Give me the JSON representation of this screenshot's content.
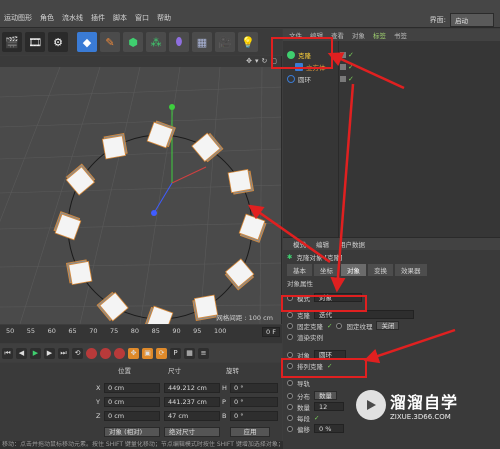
{
  "menubar": {
    "items": [
      "运动图形",
      "角色",
      "流水线",
      "插件",
      "脚本",
      "窗口",
      "帮助"
    ],
    "layout_label": "界面:",
    "layout_value": "启动"
  },
  "toolbar": {
    "icons": [
      "render-region-icon",
      "render-view-icon",
      "render-settings-icon",
      "cube-icon",
      "pen-icon",
      "subdivision-icon",
      "array-icon",
      "deformer-icon",
      "floor-icon",
      "camera-icon",
      "light-icon"
    ]
  },
  "viewport": {
    "grid_label": "网格间距 : 100 cm",
    "cubes_count": 12
  },
  "object_manager": {
    "tabs": [
      "文件",
      "编辑",
      "查看",
      "对象",
      "标签",
      "书签"
    ],
    "active_tab": "标签",
    "objects": [
      {
        "name": "克隆",
        "type": "cloner",
        "selected": true
      },
      {
        "name": "立方体",
        "type": "cube",
        "selected": false
      },
      {
        "name": "圆环",
        "type": "circle",
        "selected": false
      }
    ]
  },
  "attributes": {
    "head_tabs": [
      "模式",
      "编辑",
      "用户数据"
    ],
    "title": "克隆对象 [克隆]",
    "sub_tabs": [
      "基本",
      "坐标",
      "对象",
      "变换",
      "效果器"
    ],
    "active_sub_tab": "对象",
    "section": "对象属性",
    "mode_label": "模式",
    "mode_value": "对象",
    "clone_label": "克隆",
    "clone_value": "迭代",
    "fixed_clone": "固定克隆",
    "fixed_texture": "固定纹理",
    "fixed_texture_value": "关闭",
    "render_instances": "渲染实例",
    "object_label": "对象",
    "object_value": "圆环",
    "align_clone": "排列克隆",
    "up_vector": "导轨",
    "distribution_label": "分布",
    "distribution_value": "数量",
    "count_label": "数量",
    "count_value": "12",
    "per_segment": "每段",
    "offset_label": "偏移",
    "offset_value": "0 %"
  },
  "timeline": {
    "ticks": [
      "50",
      "55",
      "60",
      "65",
      "70",
      "75",
      "80",
      "85",
      "90",
      "95",
      "100"
    ],
    "frame": "0 F"
  },
  "coordinates": {
    "headers": [
      "位置",
      "尺寸",
      "旋转"
    ],
    "rows": [
      {
        "axis": "X",
        "pos": "0 cm",
        "size": "449.212 cm",
        "rot_axis": "H",
        "rot": "0 °"
      },
      {
        "axis": "Y",
        "pos": "0 cm",
        "size": "441.237 cm",
        "rot_axis": "P",
        "rot": "0 °"
      },
      {
        "axis": "Z",
        "pos": "0 cm",
        "size": "47 cm",
        "rot_axis": "B",
        "rot": "0 °"
      }
    ],
    "mode_value": "对象 (相对)",
    "size_mode_value": "绝对尺寸",
    "apply_label": "应用"
  },
  "statusbar": {
    "text": "移动：点击并拖动鼠标移动元素。按住 SHIFT 键量化移动；节点编辑模式时按住 SHIFT 键增加选择对象；按住 CTRL 键减少选择对象。"
  },
  "watermark": {
    "line1": "溜溜自学",
    "line2": "ZIXUE.3D66.COM"
  },
  "colors": {
    "highlight": "#e02020",
    "active_tab": "#9fd06f",
    "check": "#7bd35b"
  }
}
